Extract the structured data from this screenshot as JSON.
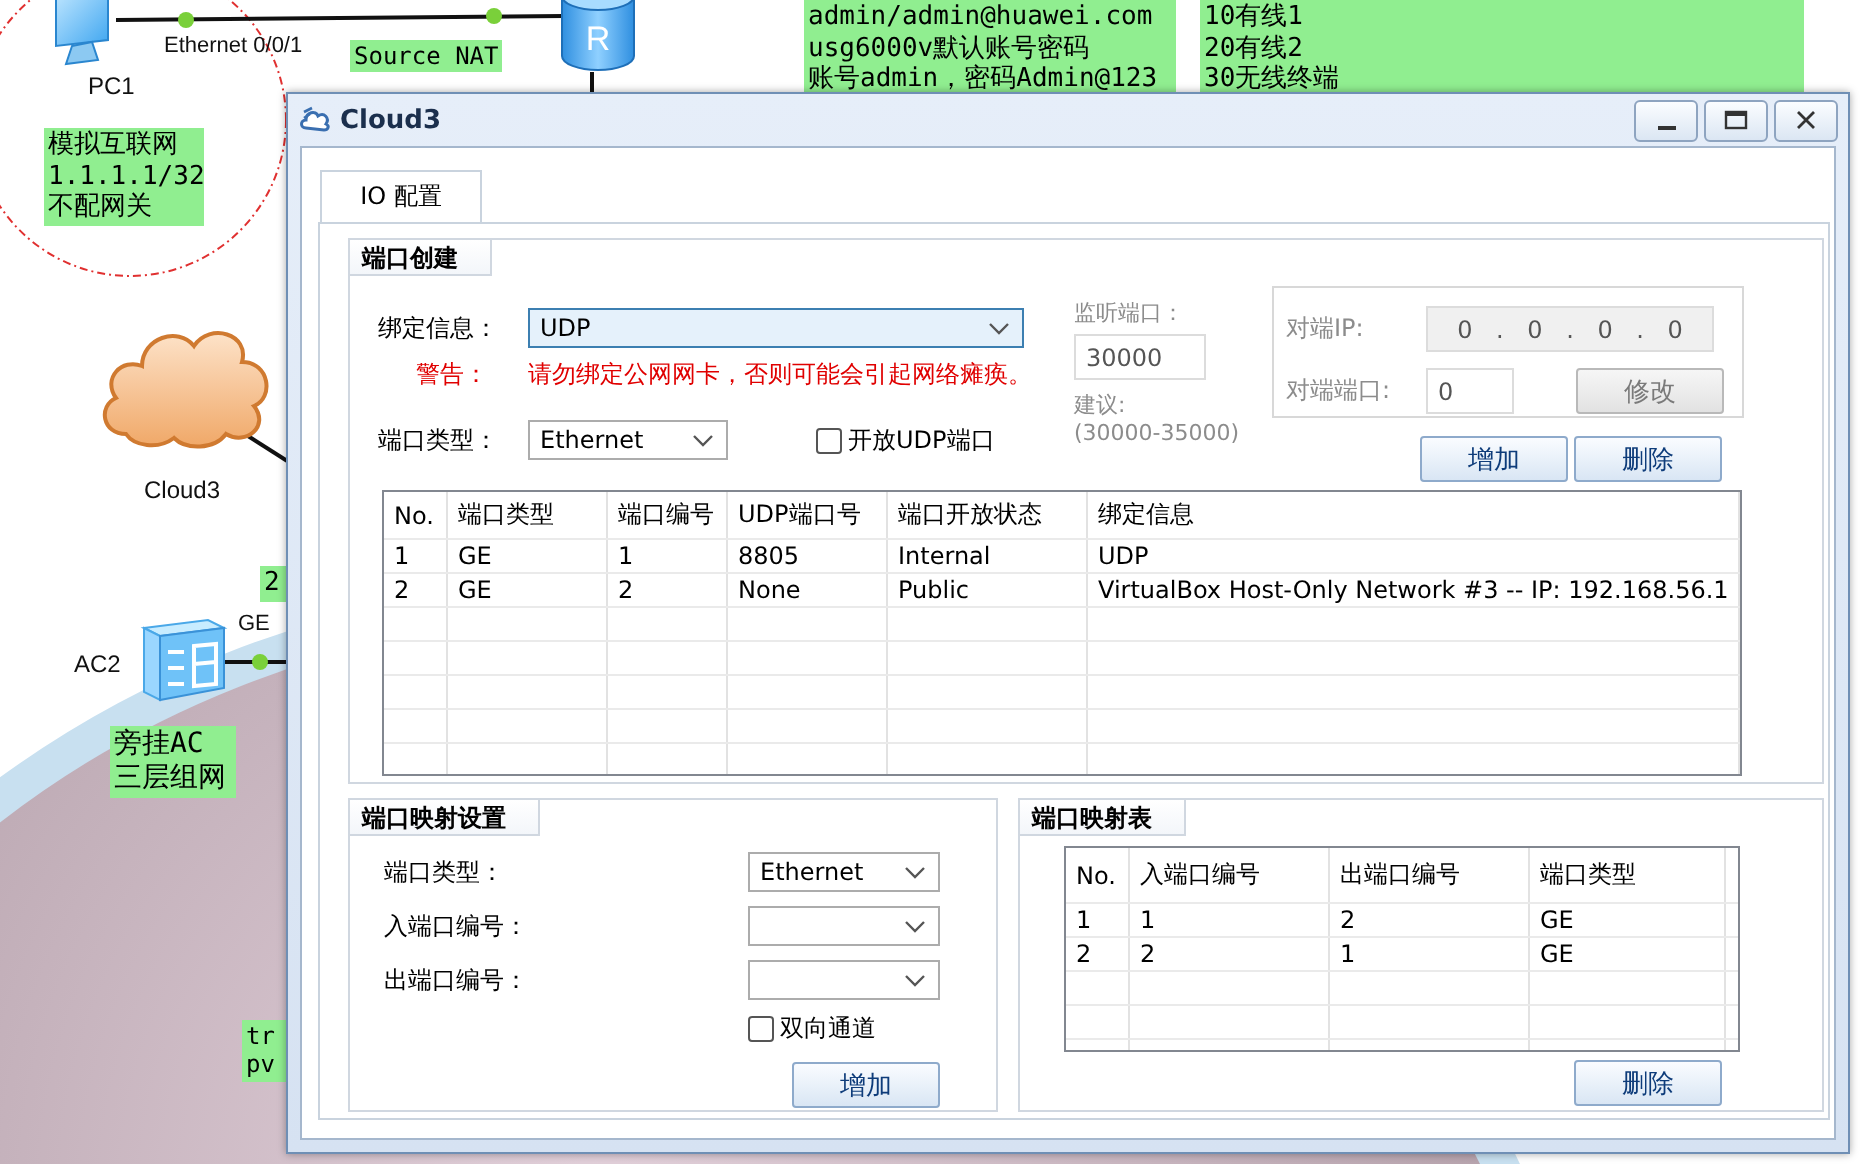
{
  "topology": {
    "notes": [
      {
        "lines": [
          "Source NAT"
        ]
      },
      {
        "lines": [
          "admin/admin@huawei.com",
          "usg6000v默认账号密码",
          "账号admin，密码Admin@123"
        ]
      },
      {
        "lines": [
          "10有线1",
          "20有线2",
          "30无线终端"
        ]
      },
      {
        "lines": [
          "模拟互联网",
          "1.1.1.1/32",
          "不配网关"
        ]
      },
      {
        "lines": [
          "2"
        ]
      },
      {
        "lines": [
          "旁挂AC",
          "三层组网"
        ]
      },
      {
        "lines": [
          "tr",
          "pv"
        ]
      }
    ],
    "nodes": [
      {
        "kind": "pc",
        "label": "PC1"
      },
      {
        "kind": "router",
        "mark": "R"
      },
      {
        "kind": "cloud",
        "label": "Cloud3"
      },
      {
        "kind": "ac",
        "label": "AC2"
      }
    ],
    "port_labels": [
      "Ethernet 0/0/1",
      "GE"
    ]
  },
  "dialog": {
    "title": "Cloud3",
    "tabs": [
      {
        "label": "IO 配置",
        "selected": true
      }
    ],
    "port_create": {
      "title": "端口创建",
      "bind": {
        "label": "绑定信息：",
        "value": "UDP",
        "focused": true
      },
      "warning": {
        "label": "警告：",
        "text": "请勿绑定公网网卡，否则可能会引起网络瘫痪。"
      },
      "port_type": {
        "label": "端口类型：",
        "value": "Ethernet"
      },
      "open_udp": {
        "label": "开放UDP端口",
        "checked": false
      },
      "listen": {
        "label": "监听端口：",
        "value": "30000",
        "hint_label": "建议:",
        "hint": "(30000-35000)",
        "disabled": true
      },
      "remote": {
        "ip_label": "对端IP:",
        "ip": "0 . 0 . 0 . 0",
        "port_label": "对端端口:",
        "port": "0",
        "modify_button": "修改",
        "disabled": true
      },
      "add_button": "增加",
      "delete_button": "删除",
      "table": {
        "columns": [
          "No.",
          "端口类型",
          "端口编号",
          "UDP端口号",
          "端口开放状态",
          "绑定信息"
        ],
        "rows": [
          [
            "1",
            "GE",
            "1",
            "8805",
            "Internal",
            "UDP"
          ],
          [
            "2",
            "GE",
            "2",
            "None",
            "Public",
            "VirtualBox Host-Only Network #3 -- IP: 192.168.56.1"
          ]
        ]
      }
    },
    "port_mapping": {
      "title": "端口映射设置",
      "port_type": {
        "label": "端口类型：",
        "value": "Ethernet"
      },
      "in_port": {
        "label": "入端口编号："
      },
      "out_port": {
        "label": "出端口编号："
      },
      "bidirectional": {
        "label": "双向通道",
        "checked": false
      },
      "add_button": "增加"
    },
    "mapping_table": {
      "title": "端口映射表",
      "columns": [
        "No.",
        "入端口编号",
        "出端口编号",
        "端口类型"
      ],
      "rows": [
        [
          "1",
          "1",
          "2",
          "GE"
        ],
        [
          "2",
          "2",
          "1",
          "GE"
        ]
      ],
      "delete_button": "删除"
    }
  }
}
